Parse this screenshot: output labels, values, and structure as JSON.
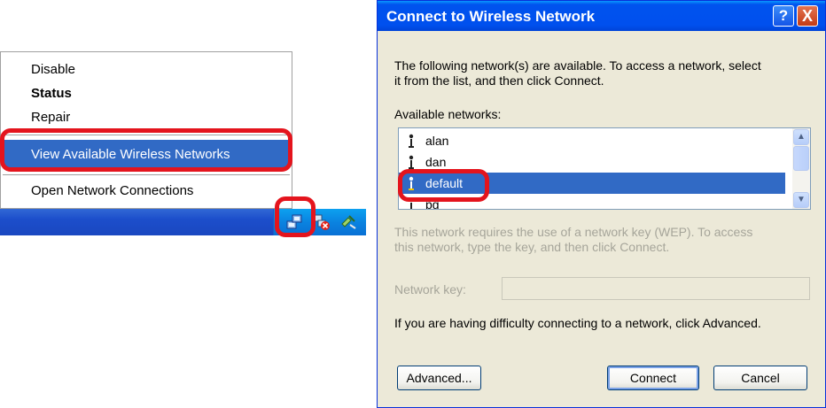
{
  "context_menu": {
    "items": [
      {
        "label": "Disable"
      },
      {
        "label": "Status"
      },
      {
        "label": "Repair"
      },
      {
        "label": "View Available Wireless Networks"
      },
      {
        "label": "Open Network Connections"
      }
    ],
    "highlighted_index": 3
  },
  "taskbar": {
    "tray_icons": [
      "network-connection-icon",
      "disconnected-network-icon",
      "safely-remove-hardware-icon"
    ]
  },
  "dialog": {
    "title": "Connect to Wireless Network",
    "help_label": "?",
    "close_label": "X",
    "intro_line1": "The following network(s) are available. To access a network, select",
    "intro_line2": "it from the list, and then click Connect.",
    "available_label": "Available networks:",
    "networks": [
      {
        "name": "alan"
      },
      {
        "name": "dan"
      },
      {
        "name": "default"
      },
      {
        "name": "pg"
      }
    ],
    "selected_network": "default",
    "wep_line1": "This network requires the use of a network key (WEP). To access",
    "wep_line2": "this network, type the key, and then click Connect.",
    "key_label": "Network key:",
    "key_value": "",
    "advanced_hint": "If you are having difficulty connecting to a network, click Advanced.",
    "advanced_button": "Advanced...",
    "connect_button": "Connect",
    "cancel_button": "Cancel"
  },
  "colors": {
    "highlight": "#316ac5",
    "callout": "#e4141d",
    "title_bar": "#0053ee",
    "dialog_bg": "#ece9d8",
    "taskbar": "#1f54cf"
  }
}
